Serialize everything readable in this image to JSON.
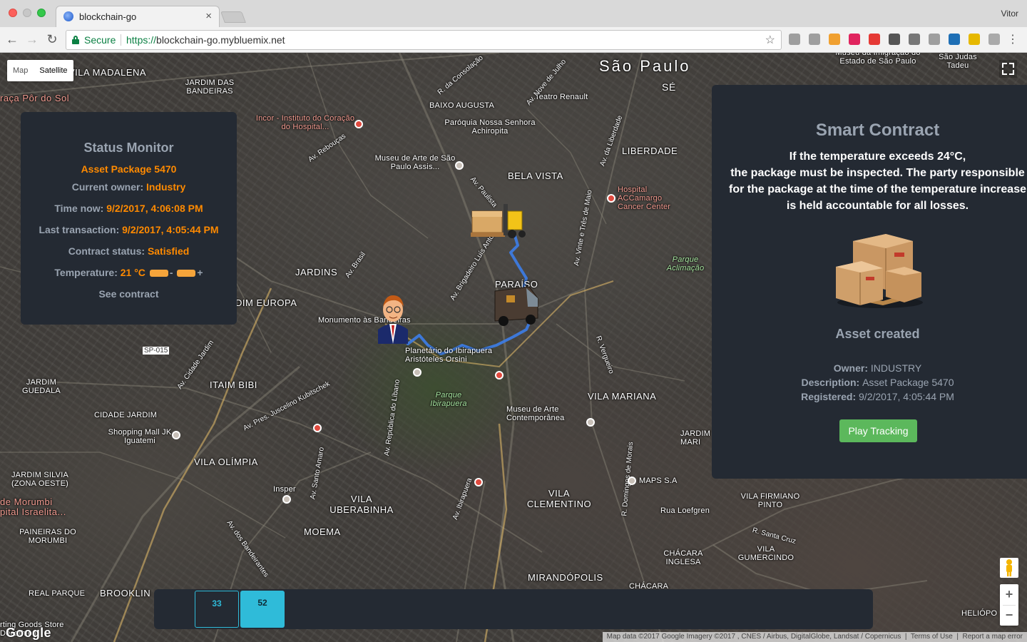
{
  "browser": {
    "tab_title": "blockchain-go",
    "tab_close": "×",
    "profile_name": "Vitor",
    "secure_label": "Secure",
    "url_scheme": "https://",
    "url_host": "blockchain-go.mybluemix.net",
    "extensions": [
      {
        "icon": "cast-icon",
        "color": "#9e9e9e"
      },
      {
        "icon": "ghost-icon",
        "color": "#9e9e9e"
      },
      {
        "icon": "cookie-icon",
        "color": "#f0a030"
      },
      {
        "icon": "tag-icon",
        "color": "#e0245e"
      },
      {
        "icon": "adblock-icon",
        "color": "#e53935"
      },
      {
        "icon": "evernote-icon",
        "color": "#555555"
      },
      {
        "icon": "pocket-icon",
        "color": "#777777"
      },
      {
        "icon": "screen-icon",
        "color": "#9e9e9e"
      },
      {
        "icon": "vue-icon",
        "color": "#1e6fb5"
      },
      {
        "icon": "pen-icon",
        "color": "#e6b800"
      },
      {
        "icon": "puzzle-icon",
        "color": "#aaaaaa"
      }
    ]
  },
  "map": {
    "map_type": {
      "map": "Map",
      "satellite": "Satellite",
      "selected": "Satellite"
    },
    "labels": {
      "sao_paulo": "São Paulo",
      "se": "SÉ",
      "vila_madalena": "VILA MADALENA",
      "jardim_das_bandeiras": "JARDIM DAS BANDEIRAS",
      "praca_por_do_sol": "raça Pôr do Sol",
      "baixo_augusta": "BAIXO AUGUSTA",
      "paroquia": "Paróquia Nossa Senhora Achiropita",
      "teatro_renault": "Teatro Renault",
      "museu_imigracao": "Museu da Imigração do Estado de São Paulo",
      "sao_judas": "São Judas Tadeu",
      "incor": "Incor - Instituto do Coração do Hospital...",
      "museu_arte_sp": "Museu de Arte de São Paulo Assis...",
      "bela_vista": "BELA VISTA",
      "liberdade": "LIBERDADE",
      "hospital_accamargo": "Hospital ACCamargo Cancer Center",
      "parque_aclimacao": "Parque Aclimação",
      "jardins": "JARDINS",
      "paraiso": "PARAÍSO",
      "jardim_europa": "DIM EUROPA",
      "monumento": "Monumento às Bandeiras",
      "planetario": "Planetário do Ibirapuera Aristóteles Orsini",
      "parque_ibirapuera": "Parque Ibirapuera",
      "museu_contemporanea": "Museu de Arte Contemporânea",
      "itaim_bibi": "ITAIM BIBI",
      "jardim_guedala": "JARDIM GUEDALA",
      "cidade_jardim": "CIDADE JARDIM",
      "shopping_mall": "Shopping Mall JK Iguatemi",
      "vila_mariana": "VILA MARIANA",
      "vila_olimpia": "VILA OLÍMPIA",
      "vila_uberabinha": "VILA UBERABINHA",
      "vila_clementino": "VILA CLEMENTINO",
      "maps_sa": "MAPS S.A",
      "insper": "Insper",
      "moema": "MOEMA",
      "vila_firmiano": "VILA FIRMIANO PINTO",
      "rua_loefgren": "Rua Loefgren",
      "jardim_silvia": "JARDIM SILVIA (ZONA OESTE)",
      "de_morumbi": "de Morumbi",
      "pital_israelita": "pital Israelita...",
      "paineiras": "PAINEIRAS DO MORUMBI",
      "real_parque": "REAL PARQUE",
      "brooklin": "BROOKLIN",
      "mirandopolis": "MIRANDÓPOLIS",
      "chacara_inglesa": "CHÁCARA INGLESA",
      "vila_gumercindo": "VILA GUMERCINDO",
      "chacara": "CHÁCARA",
      "heliopolis": "HELIÓPO",
      "jardim_mari": "JARDIM MARI",
      "sporting_goods": "rting Goods Store Decathlon",
      "av_brasil": "Av. Brasil",
      "av_reboucas": "Av. Rebouças",
      "av_paulista": "Av. Paulista",
      "av_consolacao": "R. da Consolação",
      "av_nove_julho": "Av. Nove de Julho",
      "av_23_maio": "Av. Vinte e Três de Maio",
      "av_republica_libano": "Av. República do Líbano",
      "av_ibirapuera": "Av. Ibirapuera",
      "av_santo_amaro": "Av. Santo Amaro",
      "av_juscelino": "Av. Pres. Juscelino Kubitschek",
      "av_cidade_jardim": "Av. Cidade Jardim",
      "av_bandeirantes": "Av. dos Bandeirantes",
      "av_vergueiro": "R. Vergueiro",
      "av_santa_cruz": "R. Santa Cruz",
      "av_domingos_morais": "R. Domingos de Morais",
      "av_brigadeiro": "Av. Brigadeiro Luís Antônio",
      "av_liberdade": "Av. da Liberdade",
      "sp015": "SP-015"
    },
    "attribution": "Map data ©2017 Google Imagery ©2017 , CNES / Airbus, DigitalGlobe, Landsat / Copernicus",
    "terms": "Terms of Use",
    "report": "Report a map error",
    "google_logo": "Google",
    "zoom_in": "+",
    "zoom_out": "−"
  },
  "status_monitor": {
    "title": "Status Monitor",
    "asset_name": "Asset Package 5470",
    "owner_label": "Current owner:",
    "owner_value": "Industry",
    "time_label": "Time now:",
    "time_value": "9/2/2017, 4:06:08 PM",
    "last_tx_label": "Last transaction:",
    "last_tx_value": "9/2/2017, 4:05:44 PM",
    "contract_status_label": "Contract status:",
    "contract_status_value": "Satisfied",
    "temperature_label": "Temperature:",
    "temperature_value": "21 °C",
    "temp_minus": "-",
    "temp_plus": "+",
    "see_contract": "See contract"
  },
  "smart_contract": {
    "title": "Smart Contract",
    "text_line1": "If the temperature exceeds 24°C,",
    "text_line2": "the package must be inspected. The party responsible",
    "text_line3": "for the package at the time of the temperature increase",
    "text_line4": "is held accountable for all losses.",
    "status": "Asset created",
    "owner_label": "Owner:",
    "owner_value": "INDUSTRY",
    "description_label": "Description:",
    "description_value": "Asset Package 5470",
    "registered_label": "Registered:",
    "registered_value": "9/2/2017, 4:05:44 PM",
    "play_button": "Play Tracking"
  },
  "blocks": [
    {
      "number": "33",
      "style": "outline"
    },
    {
      "number": "52",
      "style": "filled"
    }
  ]
}
